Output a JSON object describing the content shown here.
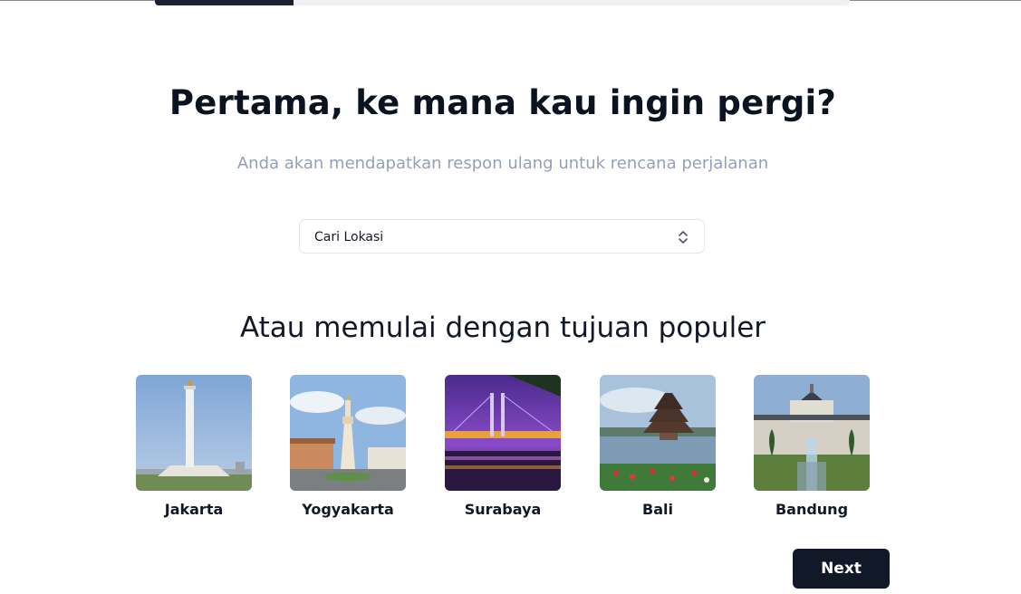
{
  "progress": {
    "value_fraction": 0.2
  },
  "heading": {
    "title": "Pertama, ke mana kau ingin pergi?",
    "subtitle": "Anda akan mendapatkan respon ulang untuk rencana perjalanan"
  },
  "search": {
    "label": "Cari Lokasi",
    "icon": "chevrons-up-down-icon"
  },
  "popular": {
    "title": "Atau memulai dengan tujuan populer",
    "destinations": [
      {
        "label": "Jakarta",
        "image": "monas-monument-photo"
      },
      {
        "label": "Yogyakarta",
        "image": "tugu-yogyakarta-photo"
      },
      {
        "label": "Surabaya",
        "image": "suramadu-bridge-night-photo"
      },
      {
        "label": "Bali",
        "image": "ulun-danu-temple-photo"
      },
      {
        "label": "Bandung",
        "image": "gedung-sate-photo"
      }
    ]
  },
  "actions": {
    "next_label": "Next"
  },
  "colors": {
    "primary": "#111827",
    "muted_text": "#93a0b7",
    "border": "#e3e6ea"
  }
}
